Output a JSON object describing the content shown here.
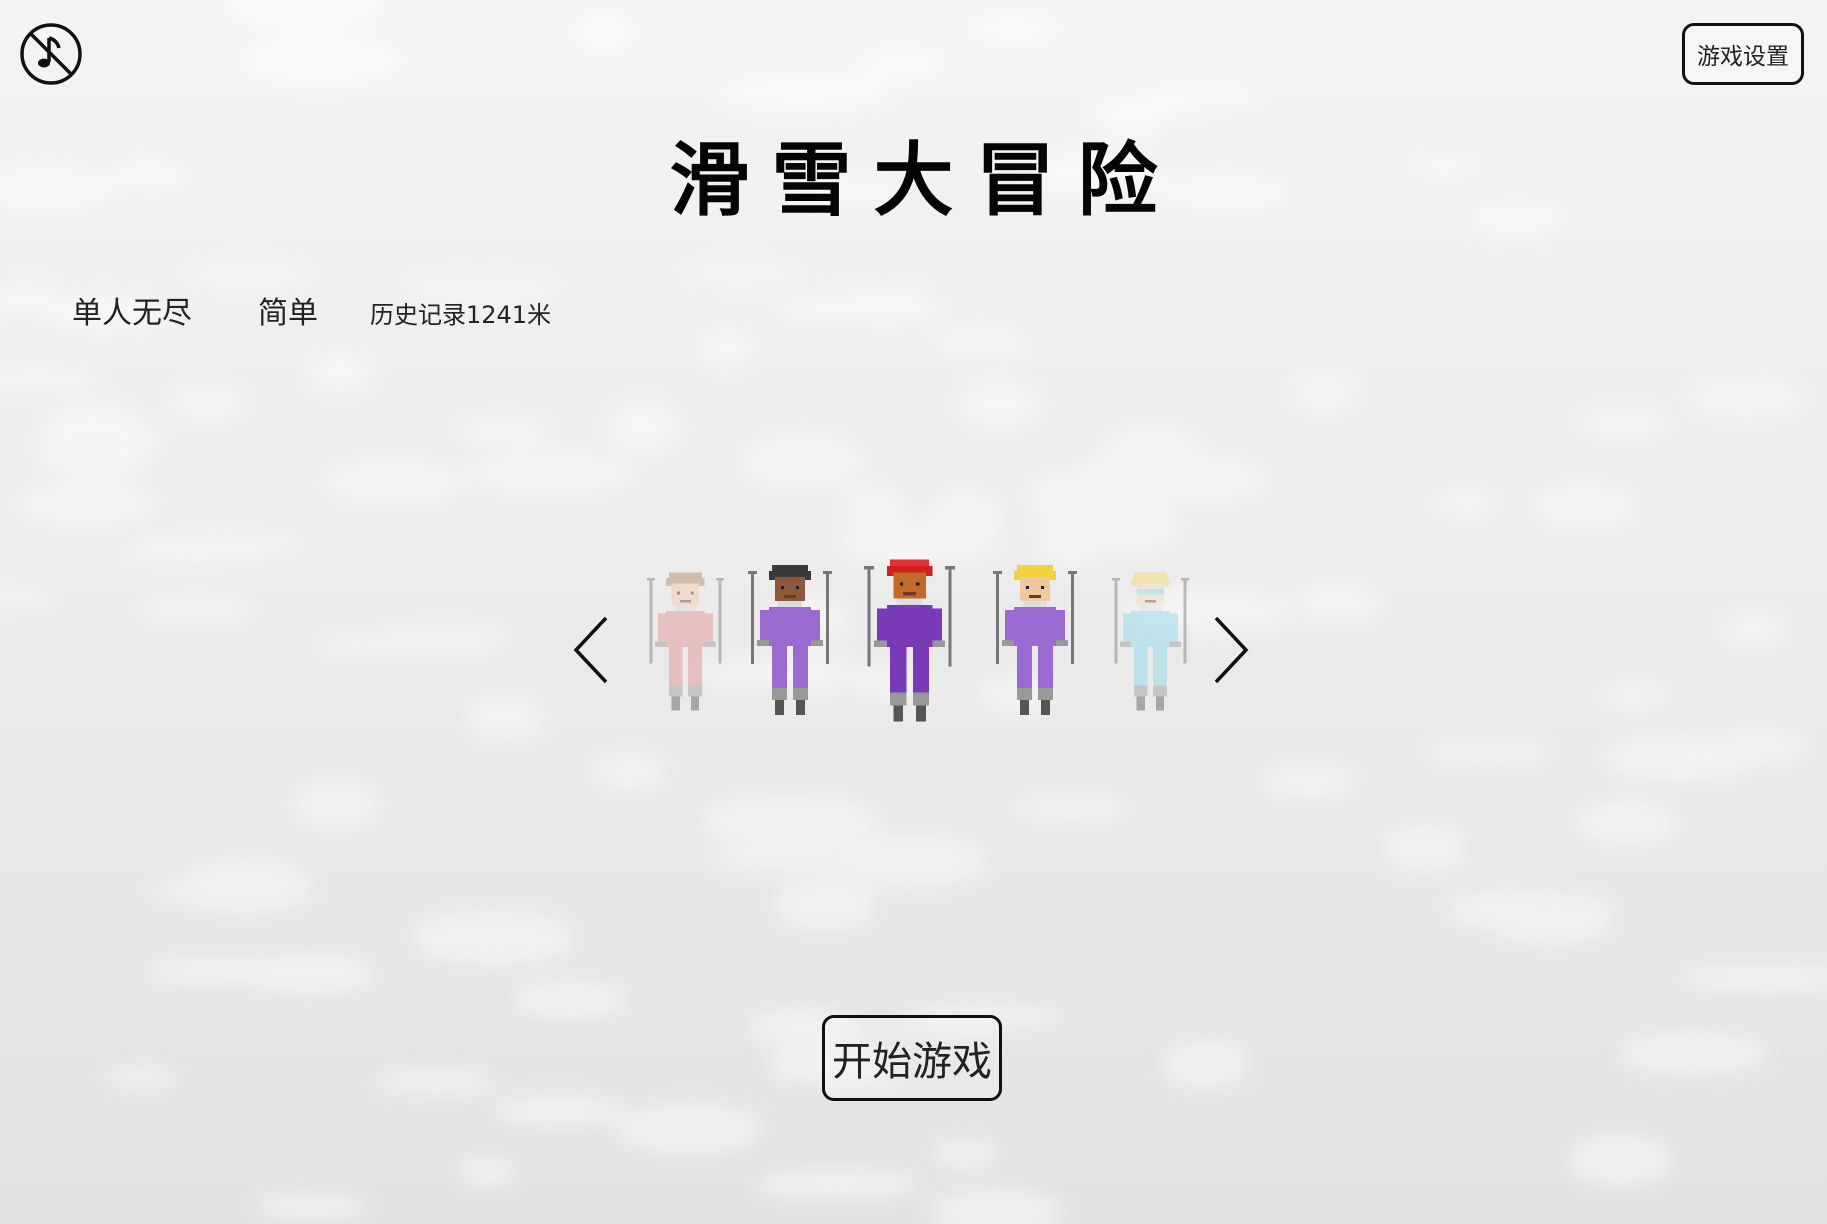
{
  "header": {
    "music_icon": "music-off-icon",
    "settings_label": "游戏设置"
  },
  "title": "滑雪大冒险",
  "options": {
    "mode_label": "单人无尽",
    "difficulty_label": "简单",
    "record_text": "历史记录1241米"
  },
  "carousel": {
    "prev_icon": "chevron-left-icon",
    "next_icon": "chevron-right-icon",
    "selected_index": 2,
    "characters": [
      {
        "name": "skier-brown-hair",
        "hair": "#b08a6a",
        "skin": "#f0c8a8",
        "suit": "#e08a8a",
        "hat": null,
        "faded": true
      },
      {
        "name": "skier-dark-hair",
        "hair": "#3a3a3a",
        "skin": "#8a5a3a",
        "suit": "#9a6ad0",
        "hat": null,
        "faded": false
      },
      {
        "name": "skier-red-bandana",
        "hair": "#d02020",
        "skin": "#c26a2a",
        "suit": "#7a3ab8",
        "hat": "#e03030",
        "faded": false
      },
      {
        "name": "skier-blonde",
        "hair": "#f2d040",
        "skin": "#f0c8a0",
        "suit": "#9a6ad0",
        "hat": null,
        "faded": false
      },
      {
        "name": "skier-goggles",
        "hair": "#f2dc60",
        "skin": "#f0d8b8",
        "suit": "#8ad8e8",
        "hat": null,
        "faded": true
      }
    ]
  },
  "start_label": "开始游戏",
  "colors": {
    "text": "#111111",
    "background": "#ececec"
  }
}
